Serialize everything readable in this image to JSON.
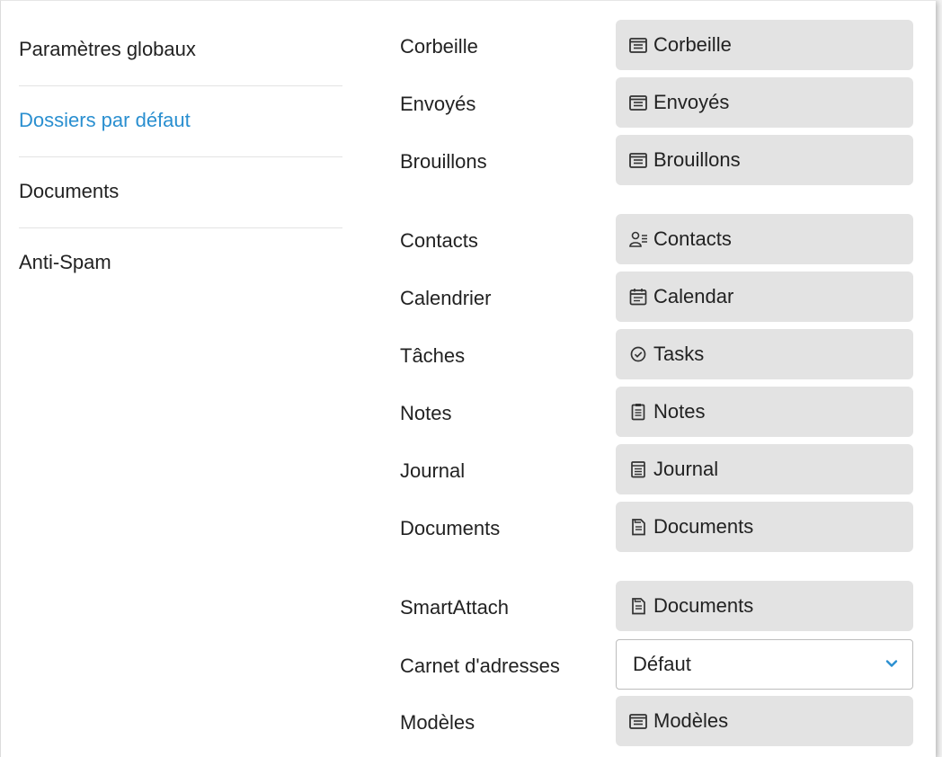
{
  "sidebar": {
    "items": [
      {
        "label": "Paramètres globaux",
        "active": false
      },
      {
        "label": "Dossiers par défaut",
        "active": true
      },
      {
        "label": "Documents",
        "active": false
      },
      {
        "label": "Anti-Spam",
        "active": false
      }
    ]
  },
  "colors": {
    "active_nav": "#2a8fd0",
    "button_bg": "#e3e3e3"
  },
  "folders": {
    "corbeille": {
      "label": "Corbeille",
      "button": "Corbeille",
      "icon": "folder-list-icon"
    },
    "envoyes": {
      "label": "Envoyés",
      "button": "Envoyés",
      "icon": "folder-list-icon"
    },
    "brouillons": {
      "label": "Brouillons",
      "button": "Brouillons",
      "icon": "folder-list-icon"
    },
    "contacts": {
      "label": "Contacts",
      "button": "Contacts",
      "icon": "contacts-icon"
    },
    "calendrier": {
      "label": "Calendrier",
      "button": "Calendar",
      "icon": "calendar-icon"
    },
    "taches": {
      "label": "Tâches",
      "button": "Tasks",
      "icon": "check-circle-icon"
    },
    "notes": {
      "label": "Notes",
      "button": "Notes",
      "icon": "clipboard-icon"
    },
    "journal": {
      "label": "Journal",
      "button": "Journal",
      "icon": "journal-icon"
    },
    "documents": {
      "label": "Documents",
      "button": "Documents",
      "icon": "document-icon"
    },
    "smartattach": {
      "label": "SmartAttach",
      "button": "Documents",
      "icon": "document-icon"
    },
    "modeles": {
      "label": "Modèles",
      "button": "Modèles",
      "icon": "folder-list-icon"
    }
  },
  "address_book": {
    "label": "Carnet d'adresses",
    "selected": "Défaut"
  }
}
